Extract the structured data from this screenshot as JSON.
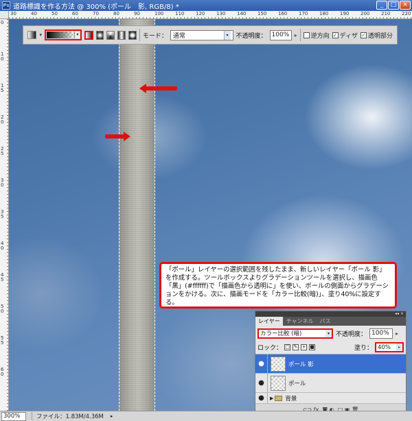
{
  "window": {
    "title": "道路標識を作る方法 @ 300% (ポール　影, RGB/8) *",
    "app_icon_text": "Ps",
    "minimize": "_",
    "maximize": "□",
    "close": "×"
  },
  "ruler": {
    "top_labels": [
      "30",
      "40",
      "50",
      "60",
      "70",
      "80",
      "90",
      "100",
      "110",
      "120",
      "130",
      "140",
      "150",
      "160",
      "170",
      "180",
      "190",
      "200",
      "210",
      "220"
    ],
    "left_labels": [
      "0",
      "1 0",
      "1 5",
      "2 0",
      "2 5",
      "3 0",
      "3 5",
      "4 0",
      "4 5",
      "5 0",
      "5 5",
      "6 0"
    ]
  },
  "options_bar": {
    "mode_label": "モード：",
    "mode_value": "通常",
    "opacity_label": "不透明度：",
    "opacity_value": "100%",
    "reverse_label": "逆方向",
    "dither_label": "ディザ",
    "transparency_label": "透明部分",
    "reverse_checked": false,
    "dither_checked": true,
    "transparency_checked": true
  },
  "note": {
    "text": "「ポール」レイヤーの選択範囲を残したまま、新しいレイヤー「ポール 影」を作成する。ツールボックスよりグラデーションツールを選択し、描画色「黒」(#ffffff)で「描画色から透明に」を使い、ポールの側面からグラデーションをかける。次に、描画モードを「カラー比較(暗)」、塗り40%に設定する。"
  },
  "layers_panel": {
    "top_controls": "◂◂ ×",
    "tabs": [
      "レイヤー",
      "チャンネル",
      "パス"
    ],
    "blend_mode": "カラー比較 (暗)",
    "opacity_label": "不透明度：",
    "opacity_value": "100%",
    "lock_label": "ロック：",
    "fill_label": "塗り：",
    "fill_value": "40%",
    "layers": [
      {
        "name": "ポール 影",
        "selected": true
      },
      {
        "name": "ポール",
        "selected": false
      }
    ],
    "group": {
      "name": "背景"
    },
    "bottom_icons": "⊂⊃  fx.  ◙  ◐.  □  ▣  🗑"
  },
  "status": {
    "zoom": "300%",
    "file_info": "ファイル：1.83M/4.36M"
  },
  "colors": {
    "accent_red": "#e01010",
    "selected_layer": "#3a6fd0",
    "sky": "#4d78ab"
  }
}
